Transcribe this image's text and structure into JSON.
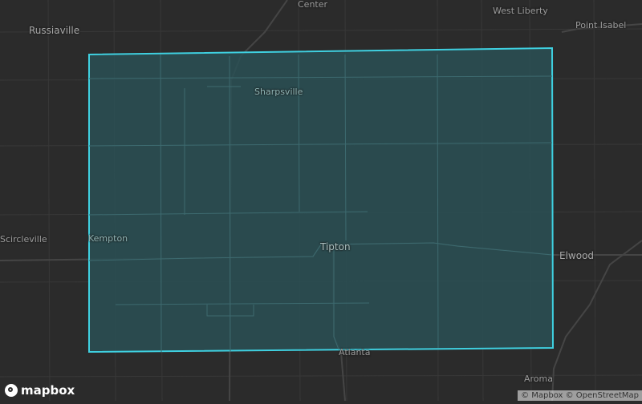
{
  "map": {
    "places": [
      {
        "id": "russiaville",
        "label": "Russiaville"
      },
      {
        "id": "center",
        "label": "Center"
      },
      {
        "id": "west-liberty",
        "label": "West Liberty"
      },
      {
        "id": "point-isabel",
        "label": "Point Isabel"
      },
      {
        "id": "sharpsville",
        "label": "Sharpsville"
      },
      {
        "id": "kempton",
        "label": "Kempton"
      },
      {
        "id": "scircleville",
        "label": "Scircleville"
      },
      {
        "id": "tipton",
        "label": "Tipton"
      },
      {
        "id": "elwood",
        "label": "Elwood"
      },
      {
        "id": "atlanta",
        "label": "Atlanta"
      },
      {
        "id": "aroma",
        "label": "Aroma"
      }
    ],
    "highlight": {
      "fill": "#2a5055",
      "stroke": "#3fd0e0"
    },
    "background_color": "#2b2b2b",
    "road_color": "#3a3a3a"
  },
  "logo": {
    "label": "mapbox",
    "icon": "mapbox-logo-icon"
  },
  "attribution": {
    "text": "© Mapbox © OpenStreetMap"
  }
}
